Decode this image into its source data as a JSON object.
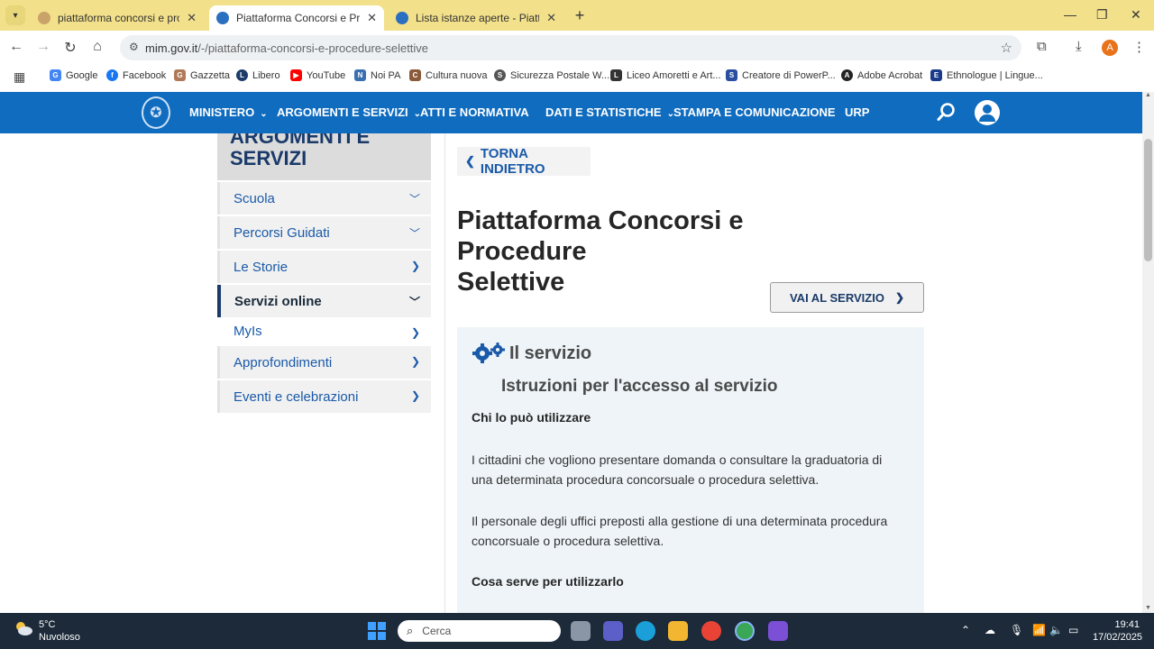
{
  "browser": {
    "tabs": [
      {
        "title": "piattaforma concorsi e procedu",
        "active": false
      },
      {
        "title": "Piattaforma Concorsi e Proced",
        "active": true
      },
      {
        "title": "Lista istanze aperte - Piattaform",
        "active": false
      }
    ],
    "url_domain": "mim.gov.it",
    "url_path": "/-/piattaforma-concorsi-e-procedure-selettive",
    "profile_initial": "A",
    "bookmarks": [
      {
        "label": "Google",
        "color": "#4285f4",
        "glyph": "G"
      },
      {
        "label": "Facebook",
        "color": "#1877f2",
        "glyph": "f"
      },
      {
        "label": "Gazzetta",
        "color": "#b07a5a",
        "glyph": "G"
      },
      {
        "label": "Libero",
        "color": "#1a3a6a",
        "glyph": "L"
      },
      {
        "label": "YouTube",
        "color": "#ff0000",
        "glyph": "▶"
      },
      {
        "label": "Noi PA",
        "color": "#3a6fb0",
        "glyph": "N"
      },
      {
        "label": "Cultura nuova",
        "color": "#8a5a3a",
        "glyph": "C"
      },
      {
        "label": "Sicurezza Postale W...",
        "color": "#555555",
        "glyph": "S"
      },
      {
        "label": "Liceo Amoretti e Art...",
        "color": "#333333",
        "glyph": "L"
      },
      {
        "label": "Creatore di PowerP...",
        "color": "#2b4fa0",
        "glyph": "S"
      },
      {
        "label": "Adobe Acrobat",
        "color": "#222222",
        "glyph": "A"
      },
      {
        "label": "Ethnologue | Lingue...",
        "color": "#1a3a8a",
        "glyph": "E"
      }
    ]
  },
  "site": {
    "nav": [
      {
        "label": "MINISTERO",
        "dropdown": true
      },
      {
        "label": "ARGOMENTI E SERVIZI",
        "dropdown": true
      },
      {
        "label": "ATTI E NORMATIVA",
        "dropdown": false
      },
      {
        "label": "DATI E STATISTICHE",
        "dropdown": true
      },
      {
        "label": "STAMPA E COMUNICAZIONE",
        "dropdown": false
      },
      {
        "label": "URP",
        "dropdown": false
      }
    ],
    "sidebar": {
      "heading_line1": "ARGOMENTI E",
      "heading_line2": "SERVIZI",
      "items": [
        {
          "label": "Scuola",
          "icon": "chevron-down"
        },
        {
          "label": "Percorsi Guidati",
          "icon": "chevron-down"
        },
        {
          "label": "Le Storie",
          "icon": "chevron-right"
        },
        {
          "label": "Servizi online",
          "icon": "chevron-down",
          "active": true
        },
        {
          "label": "MyIs",
          "icon": "chevron-right",
          "sub": true
        },
        {
          "label": "Approfondimenti",
          "icon": "chevron-right"
        },
        {
          "label": "Eventi e celebrazioni",
          "icon": "chevron-right"
        }
      ]
    },
    "back_label": "TORNA INDIETRO",
    "title_line1": "Piattaforma Concorsi e Procedure",
    "title_line2": "Selettive",
    "service_button": "VAI AL SERVIZIO",
    "card": {
      "section_title": "Il servizio",
      "subtitle": "Istruzioni per l'accesso al servizio",
      "who_heading": "Chi lo può utilizzare",
      "para1": "I cittadini che vogliono presentare domanda o consultare la graduatoria di una determinata procedura concorsuale o procedura selettiva.",
      "para2": "Il personale degli uffici preposti alla gestione di una determinata procedura concorsuale o procedura selettiva.",
      "what_heading": "Cosa serve per utilizzarlo"
    }
  },
  "taskbar": {
    "temperature": "5°C",
    "condition": "Nuvoloso",
    "search_placeholder": "Cerca",
    "time": "19:41",
    "date": "17/02/2025"
  }
}
